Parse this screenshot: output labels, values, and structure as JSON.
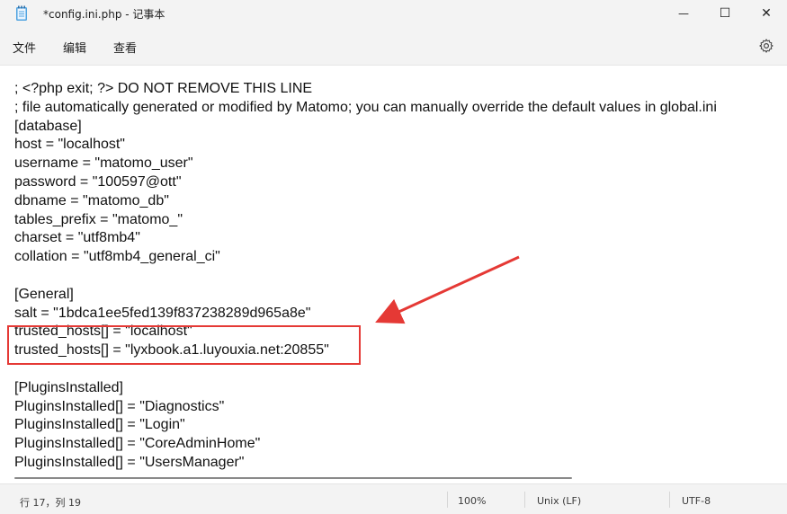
{
  "window": {
    "title": "*config.ini.php - 记事本",
    "minimize_glyph": "—",
    "maximize_glyph": "☐",
    "close_glyph": "✕"
  },
  "menu": {
    "file": "文件",
    "edit": "编辑",
    "view": "查看",
    "settings_icon": "gear-icon"
  },
  "editor": {
    "lines": [
      "; <?php exit; ?> DO NOT REMOVE THIS LINE",
      "; file automatically generated or modified by Matomo; you can manually override the default values in global.ini",
      "[database]",
      "host = \"localhost\"",
      "username = \"matomo_user\"",
      "password = \"100597@ott\"",
      "dbname = \"matomo_db\"",
      "tables_prefix = \"matomo_\"",
      "charset = \"utf8mb4\"",
      "collation = \"utf8mb4_general_ci\"",
      "",
      "[General]",
      "salt = \"1bdca1ee5fed139f837238289d965a8e\"",
      "trusted_hosts[] = \"localhost\"",
      "trusted_hosts[] = \"lyxbook.a1.luyouxia.net:20855\"",
      "",
      "[PluginsInstalled]",
      "PluginsInstalled[] = \"Diagnostics\"",
      "PluginsInstalled[] = \"Login\"",
      "PluginsInstalled[] = \"CoreAdminHome\"",
      "PluginsInstalled[] = \"UsersManager\""
    ]
  },
  "annotation": {
    "color": "#e53935"
  },
  "status": {
    "position": "行 17，列 19",
    "zoom": "100%",
    "line_ending": "Unix (LF)",
    "encoding": "UTF-8"
  }
}
